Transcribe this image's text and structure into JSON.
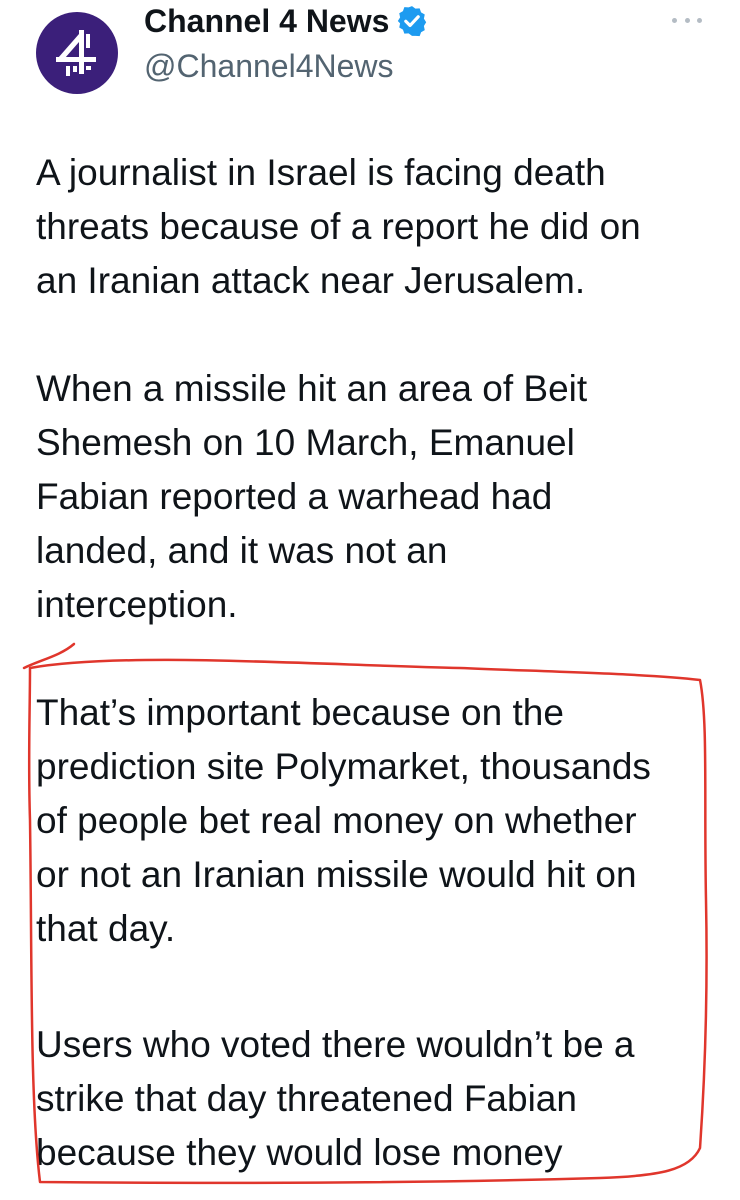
{
  "tweet": {
    "display_name": "Channel 4 News",
    "handle": "@Channel4News",
    "avatar_icon": "channel4-logo-icon",
    "verified_icon": "verified-badge-icon",
    "more_icon": "more-options-icon",
    "paragraphs": [
      {
        "lines": [
          "A journalist in Israel is facing death",
          "threats because of a report he did on",
          "an Iranian attack near Jerusalem."
        ]
      },
      {
        "lines": [
          "When a missile hit an area of Beit",
          "Shemesh on 10 March, Emanuel",
          "Fabian reported a warhead had",
          "landed, and it was not an",
          "interception."
        ]
      },
      {
        "lines": [
          "That’s important because on the",
          "prediction site Polymarket, thousands",
          "of people bet real money on whether",
          "or not an Iranian missile would hit on",
          "that day."
        ]
      },
      {
        "lines": [
          "Users who voted there wouldn’t be a",
          "strike that day threatened Fabian",
          "because they would lose money"
        ]
      }
    ]
  },
  "colors": {
    "brand": "#3b1f7a",
    "verified": "#1d9bf0",
    "text": "#0f1419",
    "secondary_text": "#536471",
    "annotation": "#e0362c"
  }
}
